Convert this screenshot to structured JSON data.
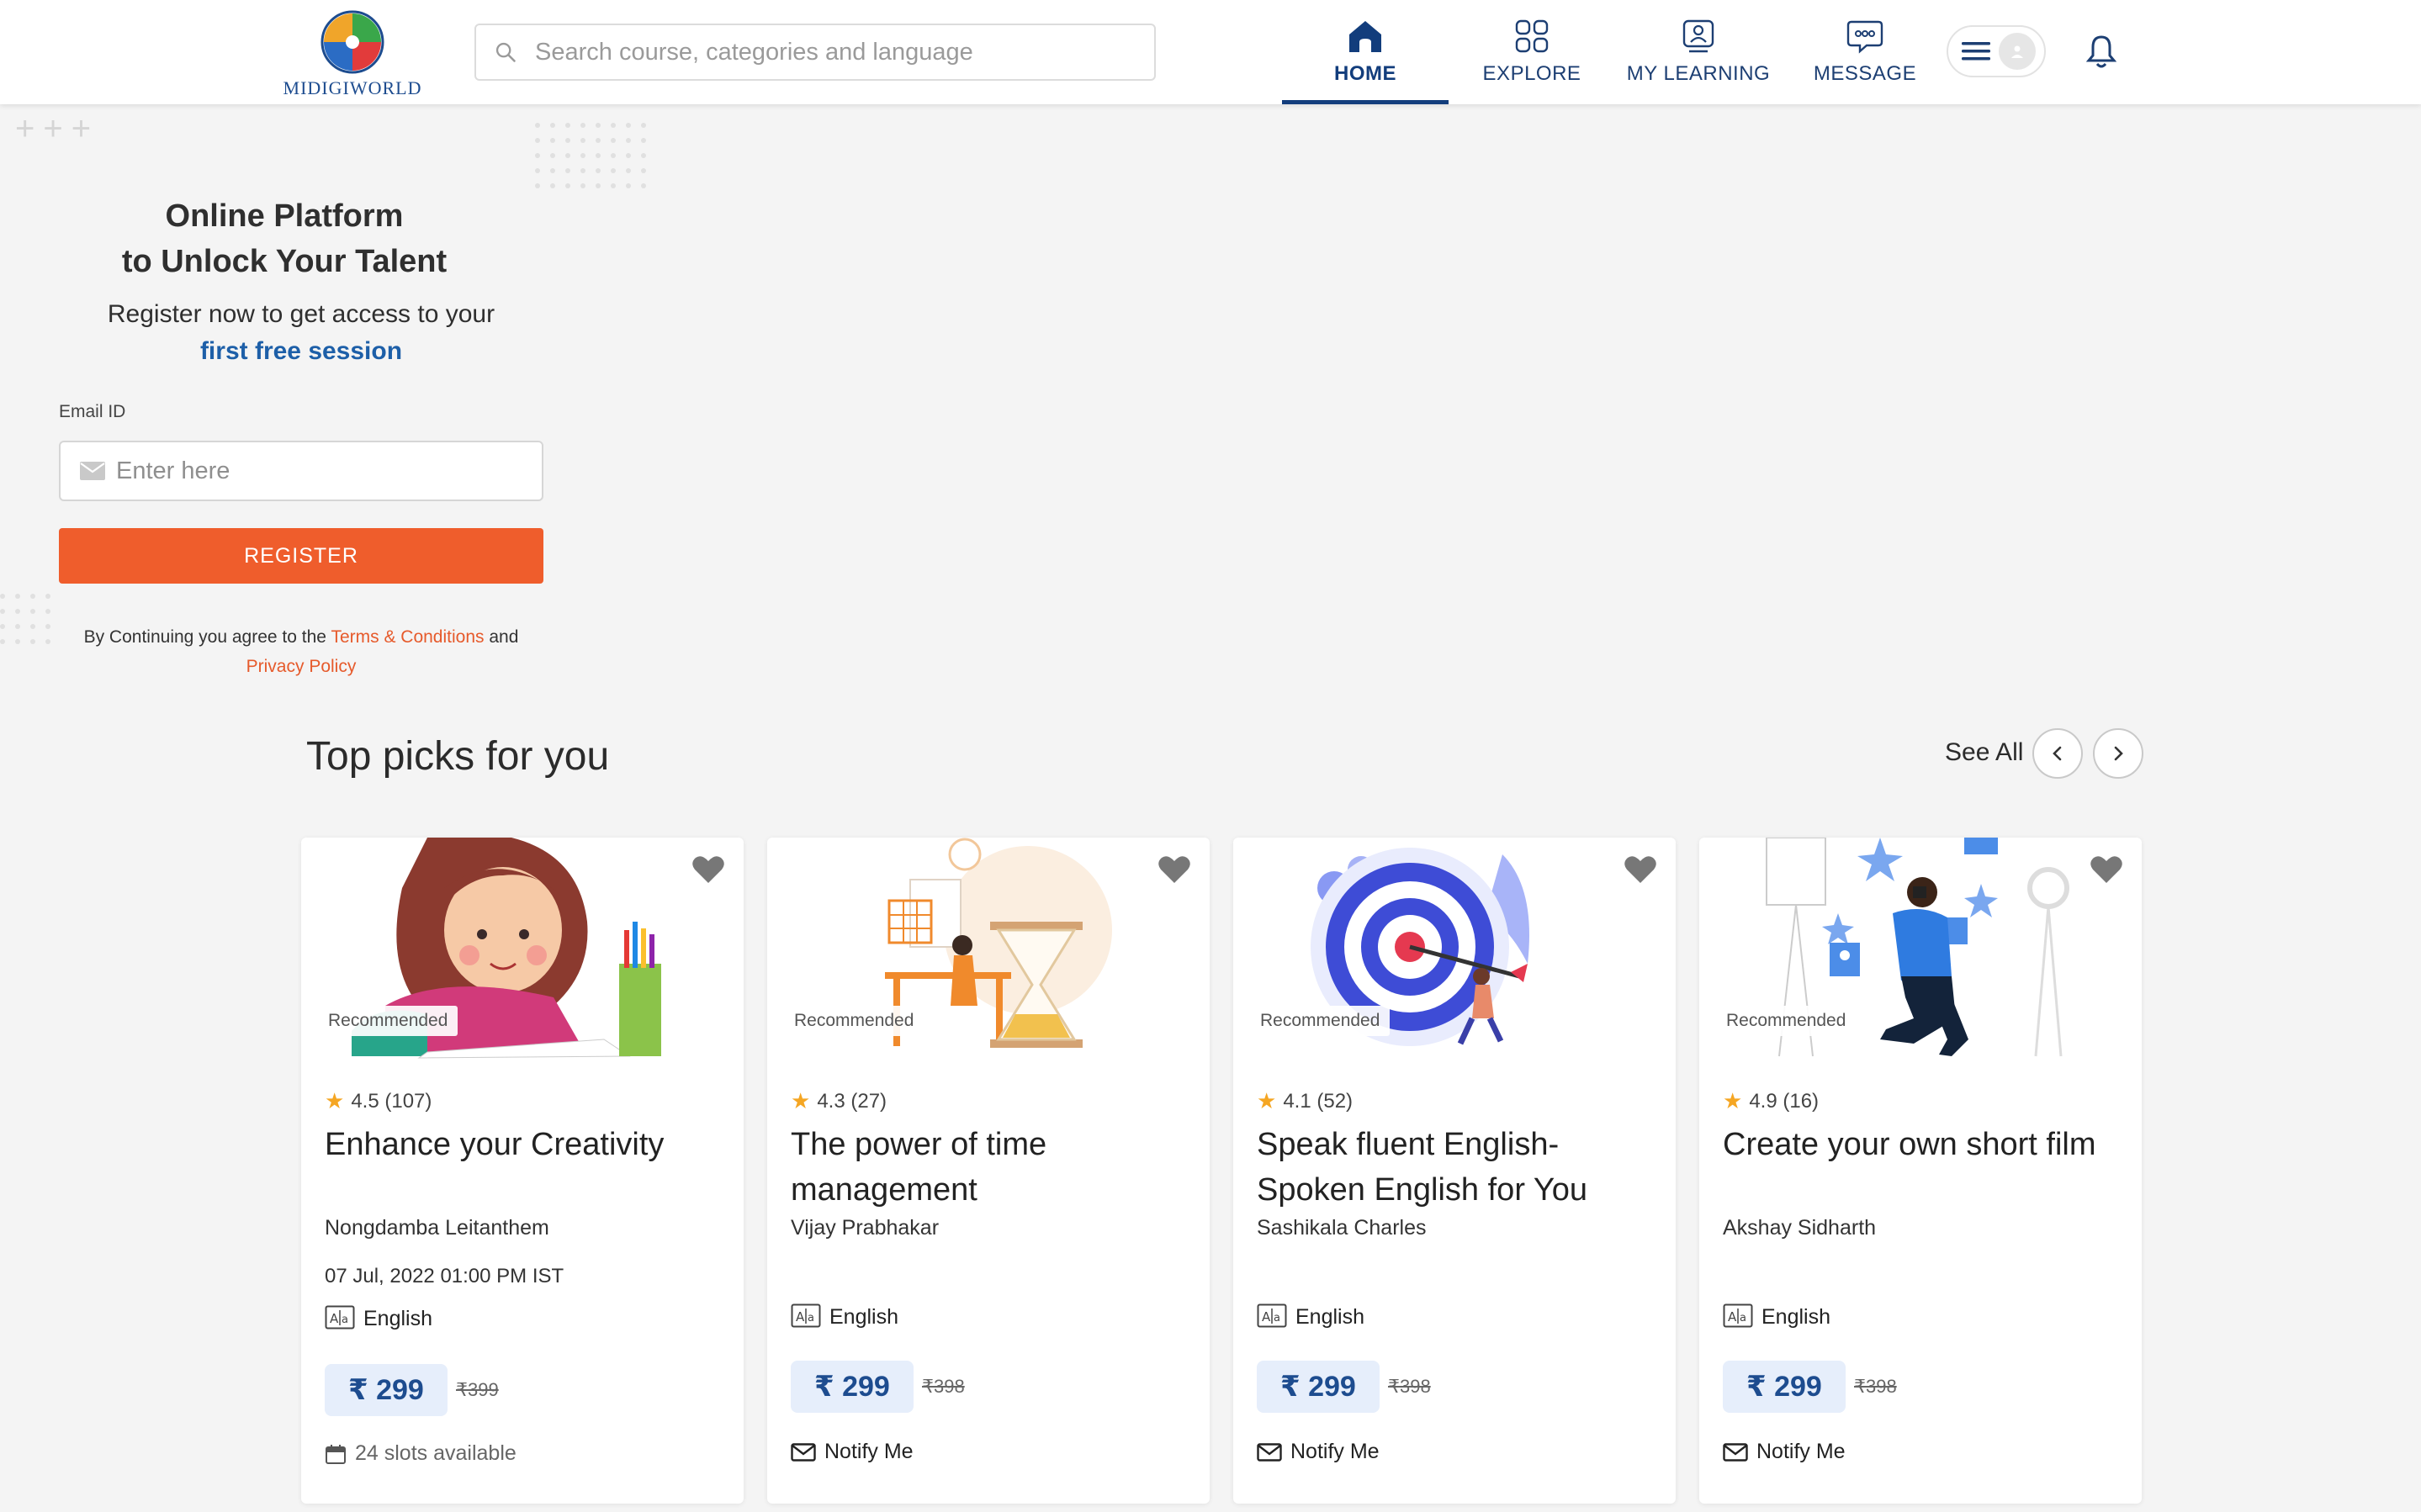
{
  "brand": {
    "name": "MIDIGIWORLD"
  },
  "search": {
    "placeholder": "Search course, categories and language"
  },
  "nav": [
    {
      "label": "HOME",
      "icon": "home-icon",
      "active": true
    },
    {
      "label": "EXPLORE",
      "icon": "explore-grid-icon",
      "active": false
    },
    {
      "label": "MY LEARNING",
      "icon": "learning-icon",
      "active": false
    },
    {
      "label": "MESSAGE",
      "icon": "message-icon",
      "active": false
    }
  ],
  "hero": {
    "title_line1": "Online Platform",
    "title_line2": "to Unlock Your Talent",
    "subtitle": "Register now to get access to your",
    "highlight": "first free session",
    "email_label": "Email ID",
    "email_placeholder": "Enter here",
    "register_label": "REGISTER",
    "terms_prefix": "By Continuing you agree to the",
    "terms_link": "Terms & Conditions",
    "terms_and": "and",
    "privacy_link": "Privacy Policy"
  },
  "top_picks": {
    "title": "Top picks for you",
    "see_all": "See All",
    "cards": [
      {
        "badge": "Recommended",
        "rating": "4.5",
        "reviews": "(107)",
        "title": "Enhance your Creativity",
        "author": "Nongdamba Leitanthem",
        "datetime": "07 Jul, 2022 01:00 PM IST",
        "language": "English",
        "price": "₹ 299",
        "old_price": "₹399",
        "footer": "24 slots available"
      },
      {
        "badge": "Recommended",
        "rating": "4.3",
        "reviews": "(27)",
        "title": "The power of time management",
        "author": "Vijay Prabhakar",
        "language": "English",
        "price": "₹ 299",
        "old_price": "₹398",
        "footer": "Notify Me"
      },
      {
        "badge": "Recommended",
        "rating": "4.1",
        "reviews": "(52)",
        "title": "Speak fluent English- Spoken English for You",
        "author": "Sashikala Charles",
        "language": "English",
        "price": "₹ 299",
        "old_price": "₹398",
        "footer": "Notify Me"
      },
      {
        "badge": "Recommended",
        "rating": "4.9",
        "reviews": "(16)",
        "title": "Create your own short film",
        "author": "Akshay Sidharth",
        "language": "English",
        "price": "₹ 299",
        "old_price": "₹398",
        "footer": "Notify Me"
      }
    ]
  },
  "colors": {
    "primary": "#123d7c",
    "accent": "#ef5d2c",
    "link_blue": "#1d5fa8",
    "price_bg": "#e6eefb",
    "star": "#f5a623"
  }
}
